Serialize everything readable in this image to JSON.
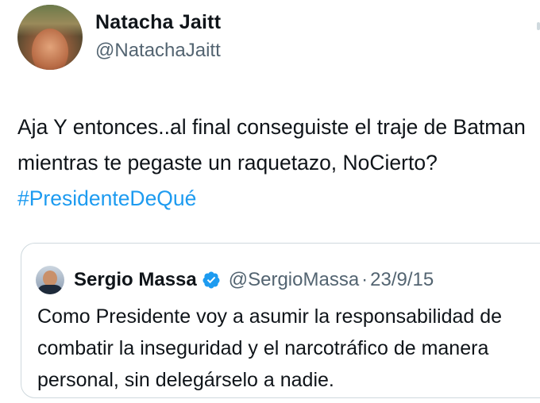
{
  "author": {
    "name": "Natacha Jaitt",
    "handle": "@NatachaJaitt"
  },
  "tweet": {
    "text": "Aja Y entonces..al final conseguiste el traje de Batman mientras te pegaste un raquetazo, NoCierto? ",
    "hashtag": "#PresidenteDeQué",
    "hashtag_color": "#1d9bf0"
  },
  "quoted": {
    "name": "Sergio Massa",
    "verified_icon": "verified-badge-icon",
    "handle": "@SergioMassa",
    "separator": "·",
    "date": "23/9/15",
    "text": "Como Presidente voy a asumir la responsabilidad de combatir la inseguridad y el narcotráfico de manera personal, sin delegárselo a nadie."
  },
  "colors": {
    "text": "#0f1419",
    "secondary": "#536471",
    "border": "#cfd9de",
    "verified": "#1d9bf0"
  }
}
